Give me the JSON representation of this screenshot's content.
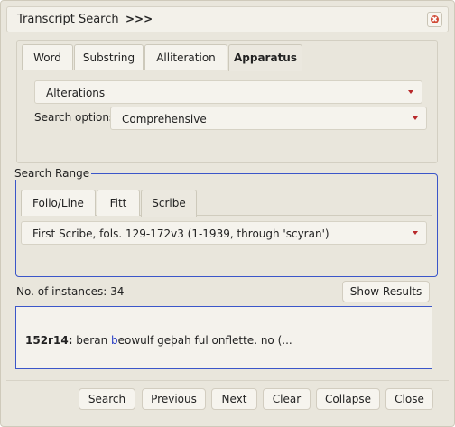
{
  "window": {
    "title": "Transcript Search",
    "expand_glyph": ">>>",
    "close_glyph": "✖"
  },
  "search_tabs": [
    {
      "label": "Word",
      "active": false
    },
    {
      "label": "Substring",
      "active": false
    },
    {
      "label": "Alliteration",
      "active": false
    },
    {
      "label": "Apparatus",
      "active": true
    }
  ],
  "apparatus": {
    "type_value": "Alterations",
    "options_label": "Search options:",
    "options_value": "Comprehensive"
  },
  "range": {
    "legend": "Search Range",
    "tabs": [
      {
        "label": "Folio/Line",
        "active": false
      },
      {
        "label": "Fitt",
        "active": false
      },
      {
        "label": "Scribe",
        "active": true
      }
    ],
    "scribe_value": "First Scribe, fols. 129-172v3 (1-1939, through 'scyran')"
  },
  "instances": {
    "label": "No. of instances: 34",
    "show_results": "Show Results"
  },
  "result": {
    "ref": "152r14:",
    "pre": " beran ",
    "hit": "b",
    "post": "eowulf geþah ful onflette. no (..."
  },
  "buttons": {
    "search": "Search",
    "previous": "Previous",
    "next": "Next",
    "clear": "Clear",
    "collapse": "Collapse",
    "close": "Close"
  },
  "colors": {
    "accent_blue": "#3b56c9",
    "caret_red": "#b8282a",
    "close_red": "#d04a35",
    "background": "#e9e6dc"
  }
}
